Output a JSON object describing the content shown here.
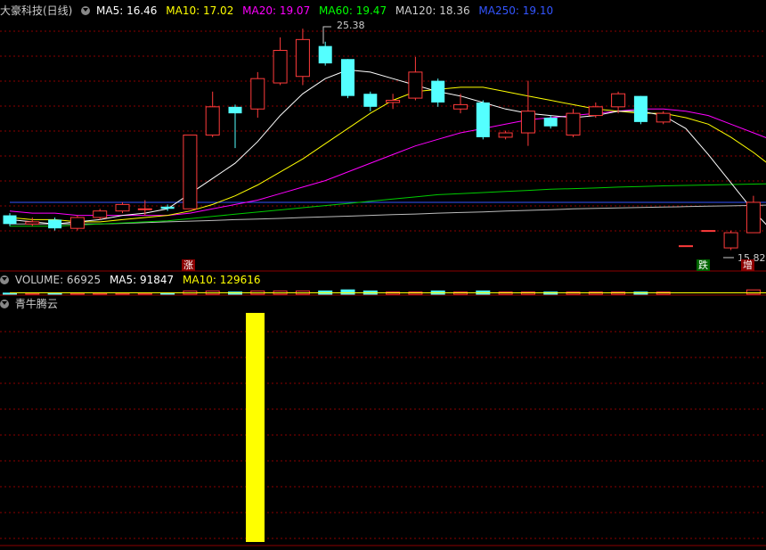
{
  "header": {
    "stock": "大豪科技(日线)",
    "ma": [
      {
        "label": "MA5: 16.46",
        "color": "#ffffff"
      },
      {
        "label": "MA10: 17.02",
        "color": "#ffff00"
      },
      {
        "label": "MA20: 19.07",
        "color": "#ff00ff"
      },
      {
        "label": "MA60: 19.47",
        "color": "#00ff00"
      },
      {
        "label": "MA120: 18.36",
        "color": "#cccccc"
      },
      {
        "label": "MA250: 19.10",
        "color": "#3355ff"
      }
    ]
  },
  "volume_header": {
    "items": [
      {
        "label": "VOLUME: 66925",
        "color": "#cccccc"
      },
      {
        "label": "MA5: 91847",
        "color": "#ffffff"
      },
      {
        "label": "MA10: 129616",
        "color": "#ffff00"
      }
    ]
  },
  "indicator_header": {
    "title": "青牛腾云"
  },
  "price_labels": {
    "high": "25.38",
    "low": "15.82"
  },
  "markers": {
    "up": "涨",
    "down": "跌",
    "increase": "增"
  },
  "colors": {
    "up": "#ff3b3b",
    "down": "#54ffff",
    "bar": "#ffff00",
    "grid": "#8b0000"
  },
  "chart_data": {
    "type": "candlestick",
    "candles": [
      {
        "o": 17.4,
        "c": 17.0,
        "h": 17.5,
        "l": 16.9
      },
      {
        "o": 17.0,
        "c": 17.1,
        "h": 17.3,
        "l": 16.9
      },
      {
        "o": 17.2,
        "c": 16.8,
        "h": 17.3,
        "l": 16.7
      },
      {
        "o": 16.8,
        "c": 17.3,
        "h": 17.4,
        "l": 16.7
      },
      {
        "o": 17.3,
        "c": 17.6,
        "h": 17.7,
        "l": 17.2
      },
      {
        "o": 17.6,
        "c": 17.9,
        "h": 18.0,
        "l": 17.5
      },
      {
        "o": 17.7,
        "c": 17.7,
        "h": 18.1,
        "l": 17.4
      },
      {
        "o": 17.8,
        "c": 17.7,
        "h": 17.9,
        "l": 17.6
      },
      {
        "o": 17.7,
        "c": 21.1,
        "h": 21.1,
        "l": 17.7
      },
      {
        "o": 21.1,
        "c": 22.4,
        "h": 23.1,
        "l": 21.0
      },
      {
        "o": 22.4,
        "c": 22.1,
        "h": 22.5,
        "l": 20.5
      },
      {
        "o": 22.3,
        "c": 23.7,
        "h": 24.0,
        "l": 21.9
      },
      {
        "o": 23.5,
        "c": 25.0,
        "h": 25.6,
        "l": 23.4
      },
      {
        "o": 23.8,
        "c": 25.5,
        "h": 26.0,
        "l": 23.4
      },
      {
        "o": 25.2,
        "c": 24.4,
        "h": 25.4,
        "l": 24.3
      },
      {
        "o": 24.6,
        "c": 22.9,
        "h": 24.6,
        "l": 22.8
      },
      {
        "o": 23.0,
        "c": 22.4,
        "h": 23.1,
        "l": 22.2
      },
      {
        "o": 22.6,
        "c": 22.7,
        "h": 23.0,
        "l": 22.3
      },
      {
        "o": 22.8,
        "c": 24.0,
        "h": 24.7,
        "l": 22.7
      },
      {
        "o": 23.6,
        "c": 22.6,
        "h": 23.7,
        "l": 22.4
      },
      {
        "o": 22.3,
        "c": 22.5,
        "h": 23.0,
        "l": 22.1
      },
      {
        "o": 22.6,
        "c": 21.0,
        "h": 22.7,
        "l": 20.9
      },
      {
        "o": 21.0,
        "c": 21.2,
        "h": 21.3,
        "l": 20.9
      },
      {
        "o": 21.2,
        "c": 22.2,
        "h": 23.6,
        "l": 20.6
      },
      {
        "o": 21.9,
        "c": 21.5,
        "h": 22.0,
        "l": 21.4
      },
      {
        "o": 21.1,
        "c": 22.1,
        "h": 22.3,
        "l": 21.0
      },
      {
        "o": 22.0,
        "c": 22.4,
        "h": 22.6,
        "l": 21.9
      },
      {
        "o": 22.4,
        "c": 23.0,
        "h": 23.1,
        "l": 22.1
      },
      {
        "o": 22.9,
        "c": 21.7,
        "h": 22.9,
        "l": 21.6
      },
      {
        "o": 21.7,
        "c": 22.1,
        "h": 22.2,
        "l": 21.6
      },
      {
        "o": 16.0,
        "c": 16.0,
        "h": 16.0,
        "l": 16.0
      },
      {
        "o": 16.7,
        "c": 16.7,
        "h": 16.7,
        "l": 16.7
      },
      {
        "o": 15.9,
        "c": 16.6,
        "h": 16.7,
        "l": 15.8
      },
      {
        "o": 16.6,
        "c": 18.0,
        "h": 18.3,
        "l": 16.6
      },
      {
        "o": 17.4,
        "c": 17.4,
        "h": 17.4,
        "l": 17.4
      }
    ],
    "ma5": [
      17.2,
      17.1,
      17.0,
      17.1,
      17.2,
      17.4,
      17.5,
      17.7,
      18.4,
      19.1,
      19.8,
      20.8,
      22.0,
      23.0,
      23.7,
      24.1,
      24.0,
      23.7,
      23.4,
      23.1,
      22.9,
      22.6,
      22.3,
      22.1,
      22.0,
      21.9,
      22.0,
      22.2,
      22.2,
      22.0,
      21.4,
      20.2,
      18.9,
      17.6,
      16.5
    ],
    "ma10": [
      17.3,
      17.2,
      17.2,
      17.1,
      17.1,
      17.2,
      17.3,
      17.4,
      17.6,
      17.9,
      18.3,
      18.8,
      19.4,
      20.0,
      20.7,
      21.4,
      22.1,
      22.7,
      23.1,
      23.2,
      23.3,
      23.3,
      23.1,
      22.9,
      22.7,
      22.5,
      22.3,
      22.2,
      22.1,
      22.1,
      21.9,
      21.6,
      21.0,
      20.3,
      19.5
    ],
    "ma20": [
      17.6,
      17.5,
      17.5,
      17.4,
      17.4,
      17.4,
      17.4,
      17.4,
      17.5,
      17.7,
      17.9,
      18.1,
      18.4,
      18.7,
      19.0,
      19.4,
      19.8,
      20.2,
      20.6,
      20.9,
      21.2,
      21.4,
      21.6,
      21.8,
      21.9,
      22.0,
      22.1,
      22.2,
      22.3,
      22.3,
      22.2,
      22.0,
      21.6,
      21.2,
      20.8
    ],
    "ma60": [
      16.9,
      16.9,
      16.9,
      16.95,
      17.0,
      17.05,
      17.1,
      17.15,
      17.25,
      17.35,
      17.45,
      17.55,
      17.65,
      17.75,
      17.85,
      17.95,
      18.05,
      18.15,
      18.25,
      18.35,
      18.4,
      18.45,
      18.5,
      18.55,
      18.6,
      18.63,
      18.66,
      18.7,
      18.73,
      18.76,
      18.78,
      18.8,
      18.82,
      18.84,
      18.86
    ],
    "ma120": [
      17.0,
      17.0,
      17.0,
      17.0,
      17.0,
      17.03,
      17.06,
      17.1,
      17.13,
      17.16,
      17.2,
      17.23,
      17.26,
      17.3,
      17.33,
      17.36,
      17.4,
      17.43,
      17.46,
      17.5,
      17.53,
      17.56,
      17.6,
      17.63,
      17.66,
      17.7,
      17.72,
      17.74,
      17.76,
      17.78,
      17.8,
      17.82,
      17.84,
      17.86,
      17.88
    ],
    "ma250": [
      18.0,
      18.0,
      18.0,
      18.0,
      18.0,
      18.0,
      18.0,
      18.0,
      18.0,
      18.0,
      18.0,
      18.0,
      18.0,
      18.0,
      18.0,
      18.0,
      18.0,
      18.0,
      18.0,
      18.0,
      18.0,
      18.0,
      18.0,
      18.0,
      18.0,
      18.0,
      18.0,
      18.0,
      18.0,
      18.0,
      18.0,
      18.0,
      18.0,
      18.0,
      18.0
    ],
    "volume": [
      1,
      1,
      1,
      1,
      1,
      1,
      1,
      1,
      3,
      3,
      2,
      3,
      3,
      3,
      3,
      4,
      3,
      2,
      2,
      3,
      2,
      3,
      2,
      2,
      2,
      2,
      2,
      2,
      2,
      2,
      0,
      0,
      0,
      4,
      3
    ],
    "indicator": [
      0,
      0,
      0,
      0,
      0,
      0,
      0,
      0,
      0,
      0,
      0,
      1,
      0,
      0,
      0,
      0,
      0,
      0,
      0,
      0,
      0,
      0,
      0,
      0,
      0,
      0,
      0,
      0,
      0,
      0,
      0,
      0,
      0,
      0,
      0
    ],
    "ylim": [
      15.0,
      26.5
    ]
  }
}
